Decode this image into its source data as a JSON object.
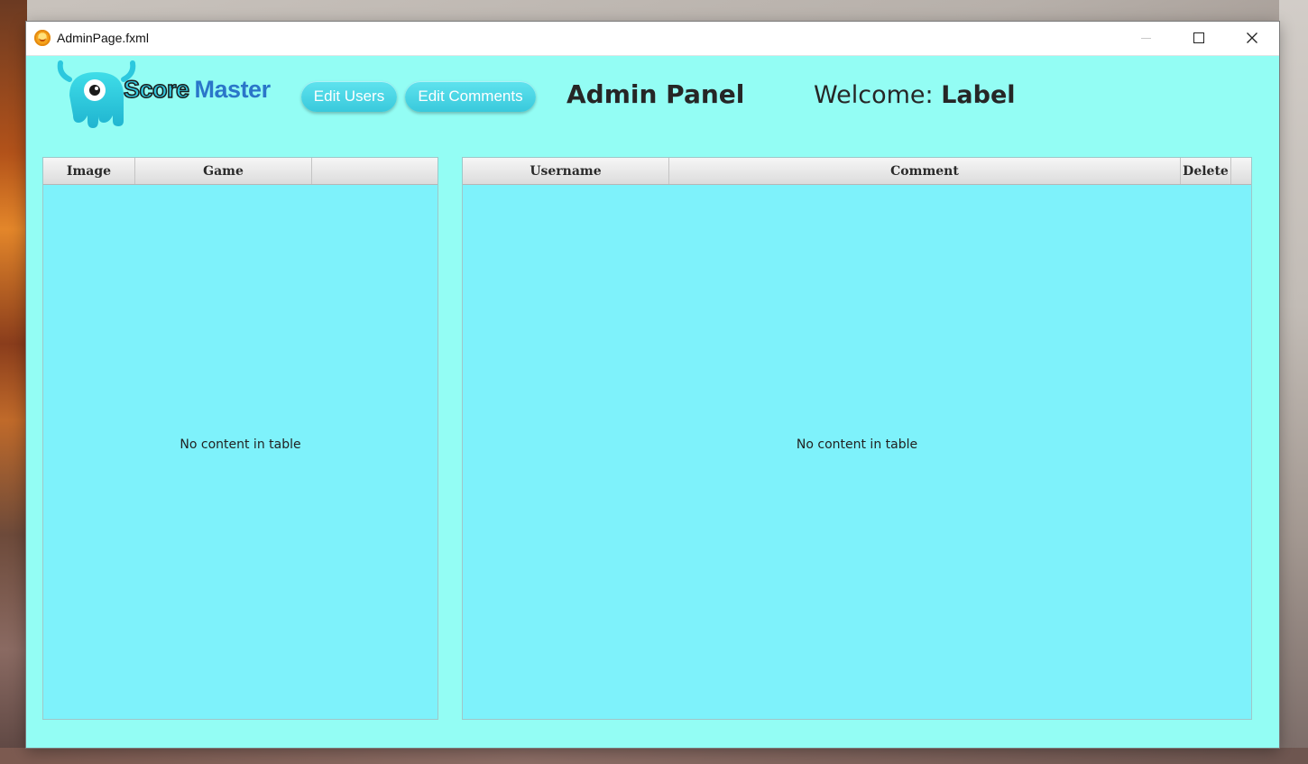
{
  "window": {
    "title": "AdminPage.fxml"
  },
  "logo": {
    "score": "Score",
    "master": "Master"
  },
  "nav": {
    "edit_users": "Edit Users",
    "edit_comments": "Edit Comments"
  },
  "header": {
    "title": "Admin Panel",
    "welcome_prefix": "Welcome:",
    "welcome_name": "Label"
  },
  "games_table": {
    "columns": [
      "Image",
      "Game",
      ""
    ],
    "placeholder": "No content in table"
  },
  "comments_table": {
    "columns": [
      "Username",
      "Comment",
      "Delete",
      ""
    ],
    "placeholder": "No content in table"
  },
  "colors": {
    "window_bg": "#93fdf4",
    "table_bg": "#7ef2fb",
    "button_bg": "#39c9dc"
  },
  "icons": {
    "app": "app-logo-icon",
    "minimize": "minimize-icon",
    "maximize": "maximize-icon",
    "close": "close-icon",
    "mascot": "monster-mascot-icon"
  }
}
